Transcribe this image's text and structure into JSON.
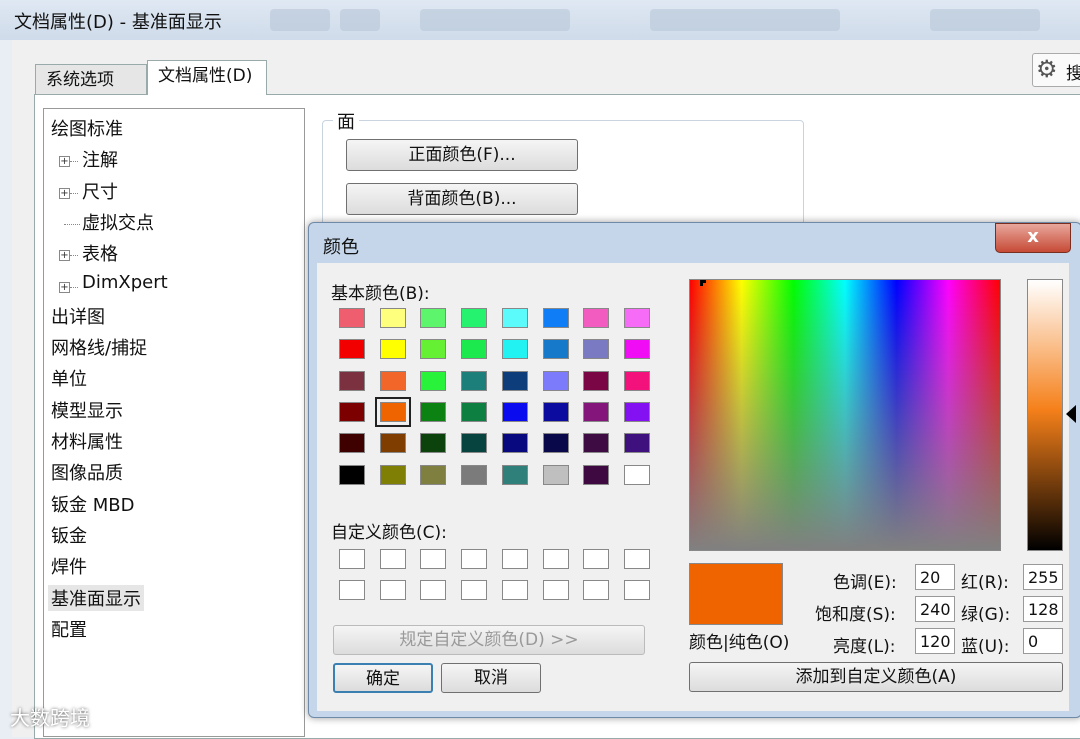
{
  "window": {
    "title": "文档属性(D) - 基准面显示",
    "search_label": "搜"
  },
  "tabs": [
    {
      "label": "系统选项(S)"
    },
    {
      "label": "文档属性(D)"
    }
  ],
  "tree": [
    {
      "label": "绘图标准",
      "level": 0
    },
    {
      "label": "注解",
      "level": 1,
      "expander": true
    },
    {
      "label": "尺寸",
      "level": 1,
      "expander": true
    },
    {
      "label": "虚拟交点",
      "level": 1,
      "expander": false
    },
    {
      "label": "表格",
      "level": 1,
      "expander": true
    },
    {
      "label": "DimXpert",
      "level": 1,
      "expander": true
    },
    {
      "label": "出详图",
      "level": 0
    },
    {
      "label": "网格线/捕捉",
      "level": 0
    },
    {
      "label": "单位",
      "level": 0
    },
    {
      "label": "模型显示",
      "level": 0
    },
    {
      "label": "材料属性",
      "level": 0
    },
    {
      "label": "图像品质",
      "level": 0
    },
    {
      "label": "钣金 MBD",
      "level": 0
    },
    {
      "label": "钣金",
      "level": 0
    },
    {
      "label": "焊件",
      "level": 0
    },
    {
      "label": "基准面显示",
      "level": 0,
      "selected": true
    },
    {
      "label": "配置",
      "level": 0
    }
  ],
  "face": {
    "legend": "面",
    "front_button": "正面颜色(F)...",
    "back_button": "背面颜色(B)..."
  },
  "dialog": {
    "title": "颜色",
    "close": "x",
    "basic_label": "基本颜色(B):",
    "basic_colors": [
      [
        "#ef5e6e",
        "#ffff7e",
        "#5cf56c",
        "#25f26e",
        "#5bfbfb",
        "#0f7ef6",
        "#f25cc0",
        "#f76cf7"
      ],
      [
        "#f20000",
        "#ffff00",
        "#66f033",
        "#1ce94e",
        "#23f2f2",
        "#1679c9",
        "#7a7ac2",
        "#f00cf5"
      ],
      [
        "#7b3140",
        "#f2662a",
        "#28f23a",
        "#1c7f7a",
        "#0d3d7a",
        "#7b7bfb",
        "#7b0645",
        "#f3127b"
      ],
      [
        "#7d0000",
        "#f06400",
        "#0c8212",
        "#0d7f40",
        "#0b0bf0",
        "#0b0b9f",
        "#83157b",
        "#8411f1"
      ],
      [
        "#3f0000",
        "#7f3d00",
        "#0c420c",
        "#074440",
        "#08087f",
        "#08084a",
        "#3e0c43",
        "#3f117f"
      ],
      [
        "#000000",
        "#7f7f05",
        "#7f7f3f",
        "#7b7b7b",
        "#2f7f7a",
        "#bfbfbf",
        "#3e0840",
        "#ffffff"
      ]
    ],
    "selected_basic": {
      "row": 3,
      "col": 1
    },
    "custom_label": "自定义颜色(C):",
    "define_button": "规定自定义颜色(D) >>",
    "ok_button": "确定",
    "cancel_button": "取消",
    "preview_label": "颜色|纯色(O)",
    "add_button": "添加到自定义颜色(A)",
    "fields": {
      "hue": {
        "label": "色调(E):",
        "value": "20"
      },
      "sat": {
        "label": "饱和度(S):",
        "value": "240"
      },
      "lum": {
        "label": "亮度(L):",
        "value": "120"
      },
      "red": {
        "label": "红(R):",
        "value": "255"
      },
      "green": {
        "label": "绿(G):",
        "value": "128"
      },
      "blue": {
        "label": "蓝(U):",
        "value": "0"
      }
    },
    "current_color": "#f06400"
  },
  "watermark": "大数跨境"
}
